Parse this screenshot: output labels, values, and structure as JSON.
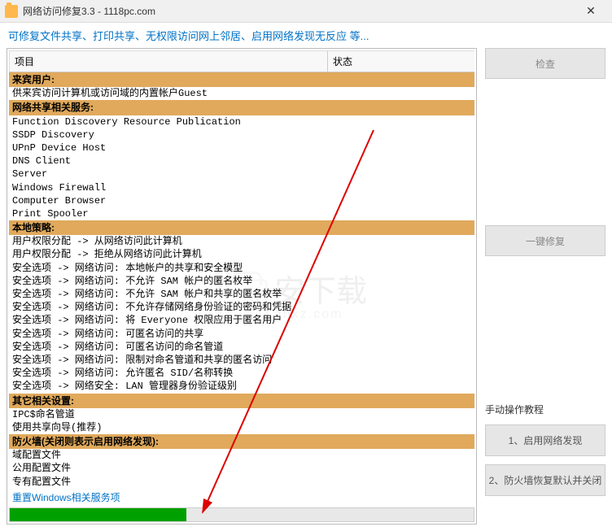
{
  "window": {
    "title": "网络访问修复3.3 - 1118pc.com"
  },
  "subtitle": "可修复文件共享、打印共享、无权限访问网上邻居、启用网络发现无反应   等...",
  "headers": {
    "project": "项目",
    "status": "状态"
  },
  "groups": [
    {
      "title": "来宾用户:",
      "items": [
        "供来宾访问计算机或访问域的内置帐户Guest"
      ]
    },
    {
      "title": "网络共享相关服务:",
      "items": [
        "Function Discovery Resource Publication",
        "SSDP Discovery",
        "UPnP Device Host",
        "DNS Client",
        "Server",
        "Windows Firewall",
        "Computer Browser",
        "Print Spooler"
      ]
    },
    {
      "title": "本地策略:",
      "items": [
        "用户权限分配 -> 从网络访问此计算机",
        "用户权限分配 -> 拒绝从网络访问此计算机",
        "安全选项 -> 网络访问: 本地帐户的共享和安全模型",
        "安全选项 -> 网络访问: 不允许 SAM 帐户的匿名枚举",
        "安全选项 -> 网络访问: 不允许 SAM 帐户和共享的匿名枚举",
        "安全选项 -> 网络访问: 不允许存储网络身份验证的密码和凭据",
        "安全选项 -> 网络访问: 将 Everyone 权限应用于匿名用户",
        "安全选项 -> 网络访问: 可匿名访问的共享",
        "安全选项 -> 网络访问: 可匿名访问的命名管道",
        "安全选项 -> 网络访问: 限制对命名管道和共享的匿名访问",
        "安全选项 -> 网络访问: 允许匿名 SID/名称转换",
        "安全选项 -> 网络安全: LAN 管理器身份验证级别"
      ]
    },
    {
      "title": "其它相关设置:",
      "items": [
        "IPC$命名管道",
        "使用共享向导(推荐)"
      ]
    },
    {
      "title": "防火墙(关闭则表示启用网络发现):",
      "items": [
        "域配置文件",
        "公用配置文件",
        "专有配置文件"
      ]
    }
  ],
  "reset_link": "重置Windows相关服务项",
  "progress_percent": 38,
  "buttons": {
    "check": "检查",
    "fix": "一键修复"
  },
  "tutorial": {
    "label": "手动操作教程",
    "b1": "1、启用网络发现",
    "b2": "2、防火墙恢复默认并关闭"
  },
  "watermark": {
    "main": "安下载",
    "sub": "anxz.com"
  }
}
